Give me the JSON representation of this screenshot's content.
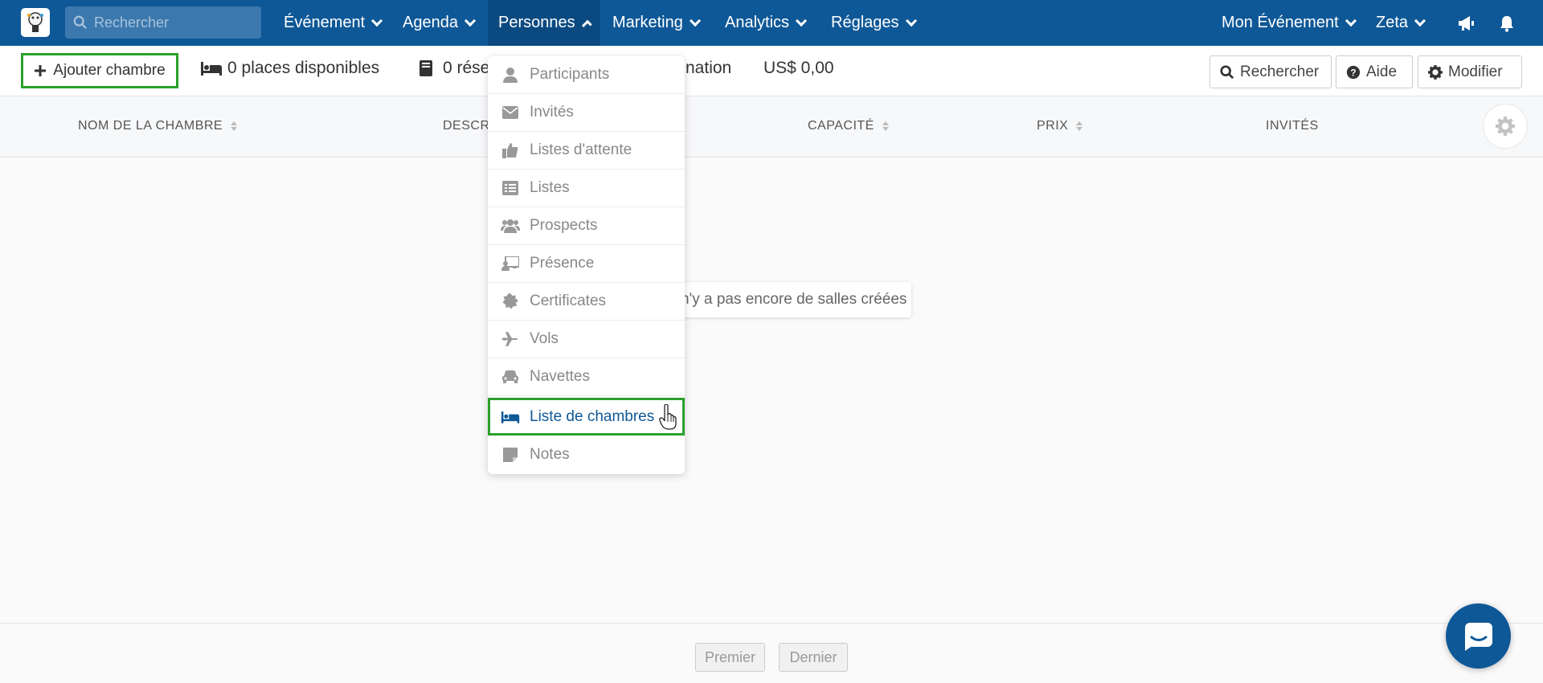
{
  "nav": {
    "search_placeholder": "Rechercher",
    "items": [
      {
        "label": "Événement"
      },
      {
        "label": "Agenda"
      },
      {
        "label": "Personnes"
      },
      {
        "label": "Marketing"
      },
      {
        "label": "Analytics"
      },
      {
        "label": "Réglages"
      }
    ],
    "event_label": "Mon Événement",
    "user_label": "Zeta",
    "colors": {
      "bar": "#0f5897",
      "active": "#0b4a81"
    }
  },
  "toolbar": {
    "add_label": "Ajouter chambre",
    "places_label": "0 places disponibles",
    "reservations_label": "0 rése",
    "confirmation_label": "nation",
    "total_label": "US$ 0,00",
    "search_label": "Rechercher",
    "help_label": "Aide",
    "edit_label": "Modifier"
  },
  "table": {
    "columns": [
      "NOM DE LA CHAMBRE",
      "DESCRI",
      "CAPACITÉ",
      "PRIX",
      "INVITÉS"
    ],
    "empty_message": "n'y a pas encore de salles créées"
  },
  "menu": {
    "items": [
      {
        "label": "Participants",
        "icon": "user-icon"
      },
      {
        "label": "Invités",
        "icon": "envelope-icon"
      },
      {
        "label": "Listes d'attente",
        "icon": "thumbs-up-icon"
      },
      {
        "label": "Listes",
        "icon": "list-icon"
      },
      {
        "label": "Prospects",
        "icon": "users-icon"
      },
      {
        "label": "Présence",
        "icon": "presence-icon"
      },
      {
        "label": "Certificates",
        "icon": "certificate-icon"
      },
      {
        "label": "Vols",
        "icon": "plane-icon"
      },
      {
        "label": "Navettes",
        "icon": "car-icon"
      },
      {
        "label": "Liste de chambres",
        "icon": "bed-icon"
      },
      {
        "label": "Notes",
        "icon": "note-icon"
      }
    ],
    "selected_index": 9,
    "highlight_color": "#2aa12a"
  },
  "pagination": {
    "first_label": "Premier",
    "last_label": "Dernier"
  }
}
